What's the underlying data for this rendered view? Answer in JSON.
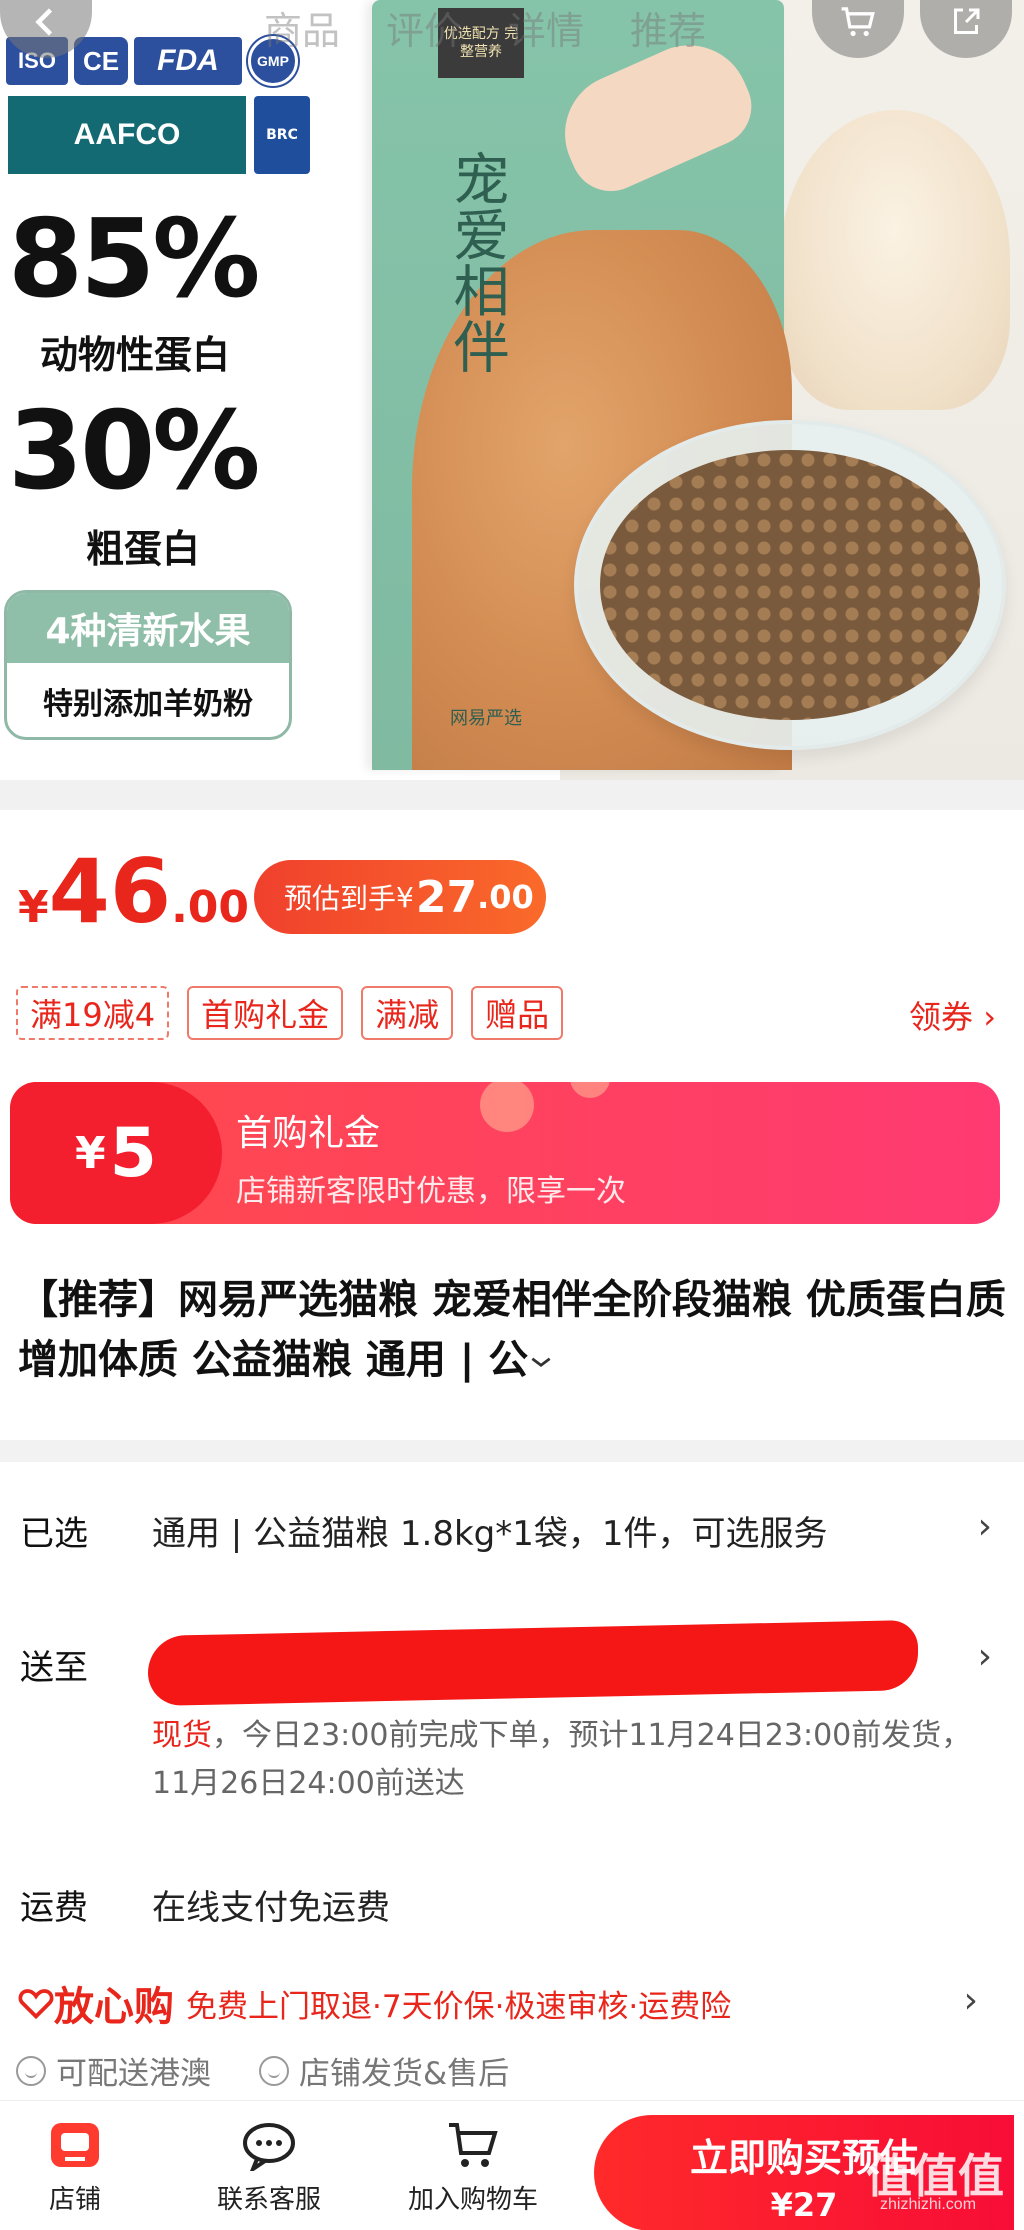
{
  "colors": {
    "accent_red": "#e8261c",
    "bag_green": "#86c4aa",
    "gift_gradient_start": "#ff4a4a",
    "gift_gradient_end": "#ff3a72"
  },
  "nav": {
    "tabs": [
      "商品",
      "评价",
      "详情",
      "推荐"
    ],
    "back_icon": "chevron-left-icon",
    "cart_icon": "cart-icon",
    "share_icon": "share-icon"
  },
  "hero": {
    "certs": {
      "iso": "ISO",
      "ce": "CE",
      "fda": "FDA",
      "gmp": "GMP",
      "aafco": "AAFCO",
      "brc": "BRC"
    },
    "stat1_value": "85%",
    "stat1_label": "动物性蛋白",
    "stat2_value": "30%",
    "stat2_label": "粗蛋白",
    "fruit_title": "4种清新水果",
    "fruit_sub": "特别添加羊奶粉",
    "bag_label": "优选配方 完整营养",
    "bag_title": "宠爱相伴",
    "bag_brand": "网易严选"
  },
  "price": {
    "currency": "¥",
    "integer": "46",
    "decimal": ".00",
    "estimate_label": "预估到手",
    "estimate_currency": "¥",
    "estimate_integer": "27",
    "estimate_decimal": ".00"
  },
  "promos": [
    "满19减4",
    "首购礼金",
    "满减",
    "赠品"
  ],
  "coupon_link": "领券 ›",
  "gift": {
    "currency": "¥",
    "amount": "5",
    "title": "首购礼金",
    "subtitle": "店铺新客限时优惠，限享一次"
  },
  "product_title": "【推荐】网易严选猫粮 宠爱相伴全阶段猫粮 优质蛋白质 增加体质 公益猫粮 通用 | 公",
  "selected": {
    "label": "已选",
    "value": "通用 | 公益猫粮 1.8kg*1袋，1件，可选服务"
  },
  "ship_to": {
    "label": "送至",
    "stock": "现货",
    "note": "，今日23:00前完成下单，预计11月24日23:00前发货，11月26日24:00前送达"
  },
  "freight": {
    "label": "运费",
    "value": "在线支付免运费"
  },
  "assurance": {
    "logo": "放心购",
    "text": "免费上门取退·7天价保·极速审核·运费险"
  },
  "extras": [
    "可配送港澳",
    "店铺发货&售后"
  ],
  "bottom_bar": {
    "shop": "店铺",
    "service": "联系客服",
    "add_cart": "加入购物车",
    "buy_label": "立即购买预估",
    "buy_price": "¥27"
  },
  "watermark": {
    "mark": "值值值",
    "url": "zhizhizhi.com"
  }
}
